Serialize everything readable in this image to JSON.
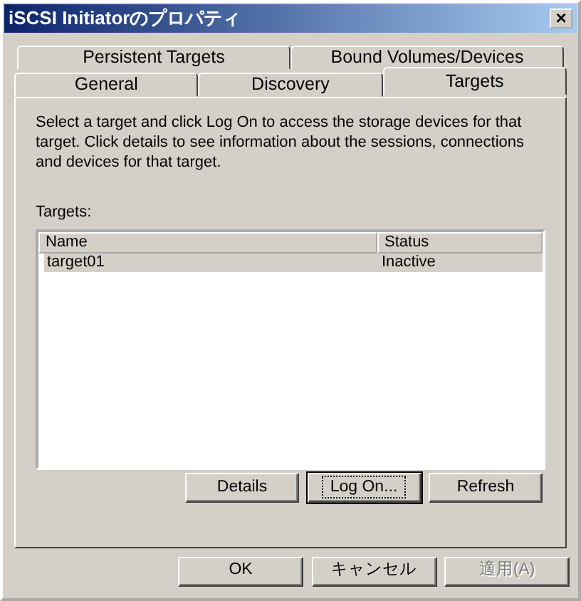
{
  "window": {
    "title": "iSCSI Initiatorのプロパティ",
    "close": "×"
  },
  "tab_rows": [
    [
      {
        "label": "Persistent Targets",
        "selected": false
      },
      {
        "label": "Bound Volumes/Devices",
        "selected": false
      }
    ],
    [
      {
        "label": "General",
        "selected": false
      },
      {
        "label": "Discovery",
        "selected": false
      },
      {
        "label": "Targets",
        "selected": true
      }
    ]
  ],
  "description": "Select a target and click Log On to access the storage devices for that target. Click details to see information about the sessions, connections and devices for that target.",
  "targets": {
    "label": "Targets:",
    "columns": [
      "Name",
      "Status"
    ],
    "rows": [
      {
        "cells": [
          "target01",
          "Inactive"
        ],
        "selected": true
      }
    ]
  },
  "panel_buttons": [
    {
      "label": "Details",
      "default": false
    },
    {
      "label": "Log On...",
      "default": true
    },
    {
      "label": "Refresh",
      "default": false
    }
  ],
  "dialog_buttons": [
    {
      "label": "OK",
      "disabled": false
    },
    {
      "label": "キャンセル",
      "disabled": false
    },
    {
      "label": "適用(A)",
      "disabled": true
    }
  ]
}
